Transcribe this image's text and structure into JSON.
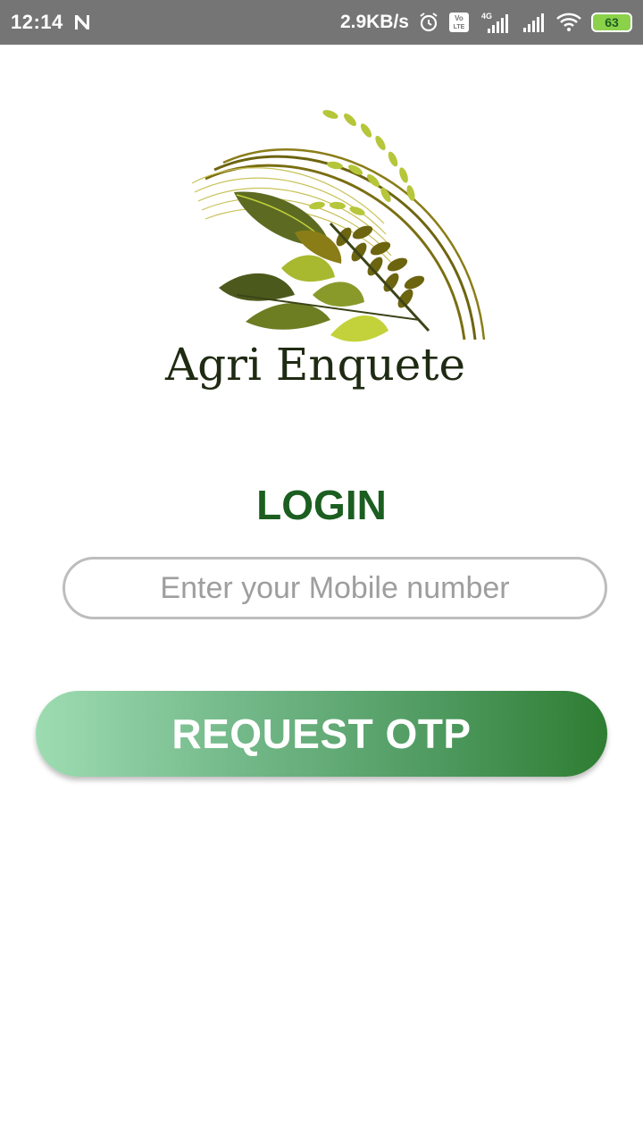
{
  "status_bar": {
    "time": "12:14",
    "network_speed": "2.9KB/s",
    "network_type": "4G",
    "volte": "Vo LTE",
    "battery_level": "63",
    "icons": [
      "notification-n-icon",
      "alarm-icon",
      "volte-icon",
      "signal-icon",
      "signal-icon",
      "wifi-icon",
      "battery-icon"
    ]
  },
  "logo": {
    "text": "Agri Enquete",
    "colors": {
      "dark_leaf": "#4b5a1c",
      "mid_leaf": "#8a9a2a",
      "light_leaf": "#c3d23a",
      "stalk": "#7a6e12"
    }
  },
  "login": {
    "title": "LOGIN",
    "mobile_placeholder": "Enter your Mobile number",
    "mobile_value": "",
    "request_otp_label": "REQUEST OTP"
  },
  "theme": {
    "title_color": "#1b5e20",
    "button_gradient_start": "#9ddcb1",
    "button_gradient_end": "#2e7d32"
  }
}
